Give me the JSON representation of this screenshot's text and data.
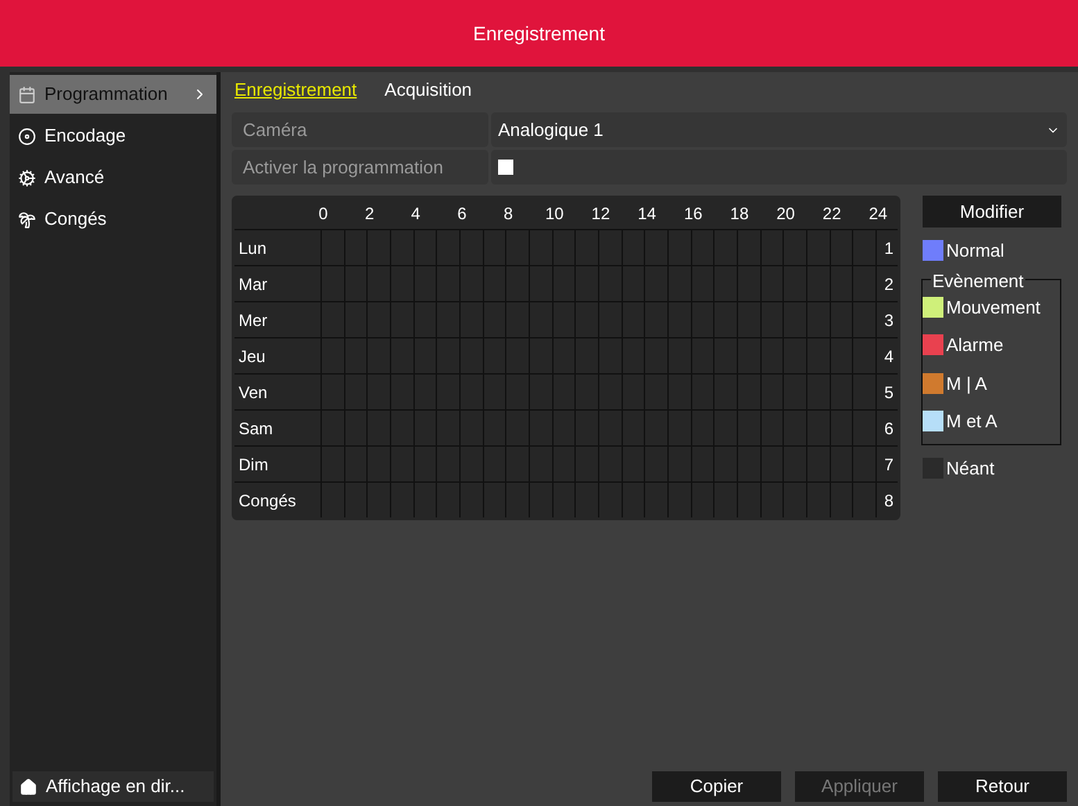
{
  "window": {
    "title": "Enregistrement"
  },
  "sidebar": {
    "items": [
      {
        "label": "Programmation",
        "selected": true
      },
      {
        "label": "Encodage",
        "selected": false
      },
      {
        "label": "Avancé",
        "selected": false
      },
      {
        "label": "Congés",
        "selected": false
      }
    ],
    "footer": {
      "label": "Affichage en dir..."
    }
  },
  "tabs": [
    {
      "label": "Enregistrement",
      "selected": true
    },
    {
      "label": "Acquisition",
      "selected": false
    }
  ],
  "camera": {
    "label": "Caméra",
    "value": "Analogique 1"
  },
  "enable": {
    "label": "Activer la programmation",
    "checked": false
  },
  "schedule": {
    "hours": [
      "0",
      "2",
      "4",
      "6",
      "8",
      "10",
      "12",
      "14",
      "16",
      "18",
      "20",
      "22",
      "24"
    ],
    "rows": [
      {
        "day": "Lun",
        "number": "1"
      },
      {
        "day": "Mar",
        "number": "2"
      },
      {
        "day": "Mer",
        "number": "3"
      },
      {
        "day": "Jeu",
        "number": "4"
      },
      {
        "day": "Ven",
        "number": "5"
      },
      {
        "day": "Sam",
        "number": "6"
      },
      {
        "day": "Dim",
        "number": "7"
      },
      {
        "day": "Congés",
        "number": "8"
      }
    ]
  },
  "legend": {
    "edit_button": "Modifier",
    "normal": {
      "label": "Normal",
      "color": "#6f7dfb"
    },
    "event_group": {
      "title": "Evènement",
      "items": [
        {
          "label": "Mouvement",
          "color": "#cff07a"
        },
        {
          "label": "Alarme",
          "color": "#e9414f"
        },
        {
          "label": "M | A",
          "color": "#d07a2e"
        },
        {
          "label": "M et A",
          "color": "#b6def8"
        }
      ]
    },
    "none": {
      "label": "Néant",
      "color": "#2b2b2b"
    }
  },
  "buttons": [
    {
      "label": "Copier",
      "disabled": false
    },
    {
      "label": "Appliquer",
      "disabled": true
    },
    {
      "label": "Retour",
      "disabled": false
    }
  ]
}
